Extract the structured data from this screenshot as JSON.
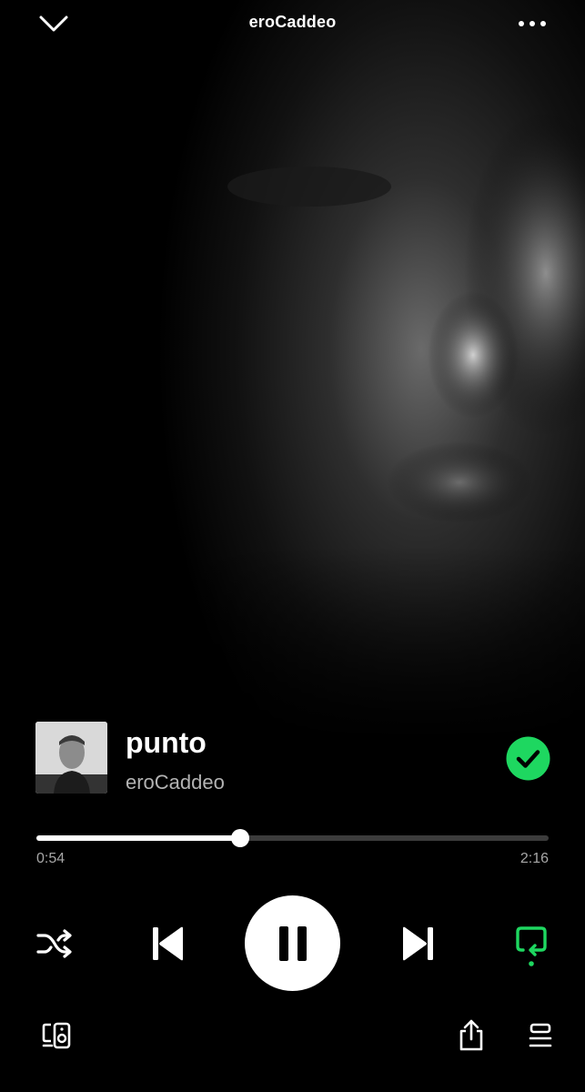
{
  "header": {
    "title": "eroCaddeo"
  },
  "track": {
    "title": "punto",
    "artist": "eroCaddeo",
    "liked": true
  },
  "playback": {
    "elapsed": "0:54",
    "duration": "2:16",
    "progress_fraction": 0.397,
    "state": "playing",
    "shuffle": false,
    "repeat": true
  },
  "icons": {
    "collapse": "chevron-down-icon",
    "more": "more-options-icon",
    "liked": "check-circle-icon",
    "shuffle": "shuffle-icon",
    "previous": "skip-previous-icon",
    "pause": "pause-icon",
    "next": "skip-next-icon",
    "repeat": "repeat-icon",
    "devices": "connect-devices-icon",
    "share": "share-icon",
    "queue": "queue-icon"
  },
  "colors": {
    "accent": "#1ed760",
    "background": "#000000",
    "secondary_text": "#b3b3b3"
  }
}
